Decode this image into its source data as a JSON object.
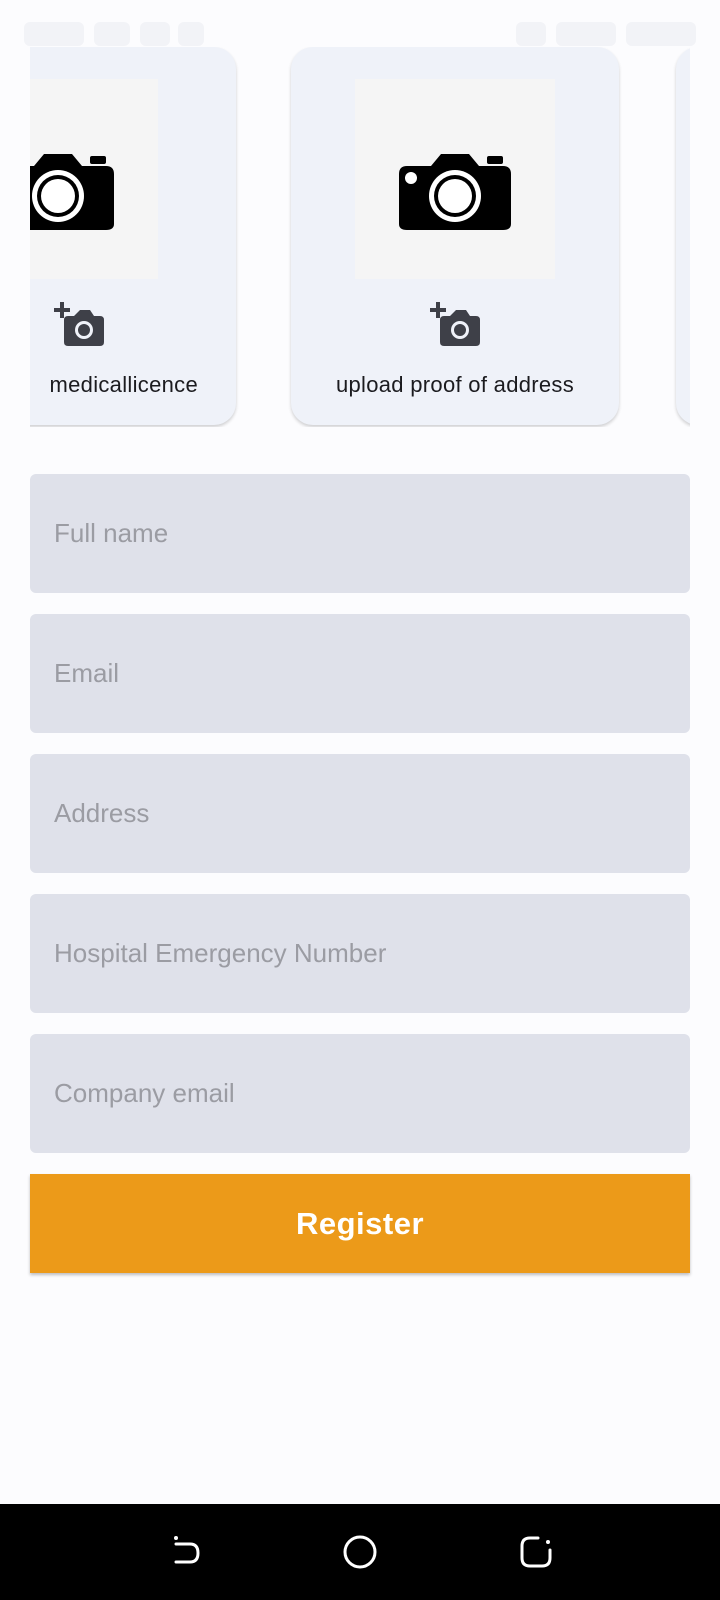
{
  "cards": [
    {
      "label": "medicallicence"
    },
    {
      "label": "upload proof of address"
    },
    {
      "label": ""
    }
  ],
  "form": {
    "full_name_placeholder": "Full name",
    "email_placeholder": "Email",
    "address_placeholder": "Address",
    "hospital_number_placeholder": "Hospital Emergency Number",
    "company_email_placeholder": "Company email"
  },
  "register_label": "Register",
  "colors": {
    "accent": "#ec9a19",
    "field_bg": "#dfe1ea",
    "card_bg": "#eff2f9"
  },
  "icons": {
    "camera": "camera-icon",
    "add_photo": "add-a-photo-icon",
    "nav_back": "back-icon",
    "nav_home": "home-icon",
    "nav_recents": "recents-icon"
  }
}
